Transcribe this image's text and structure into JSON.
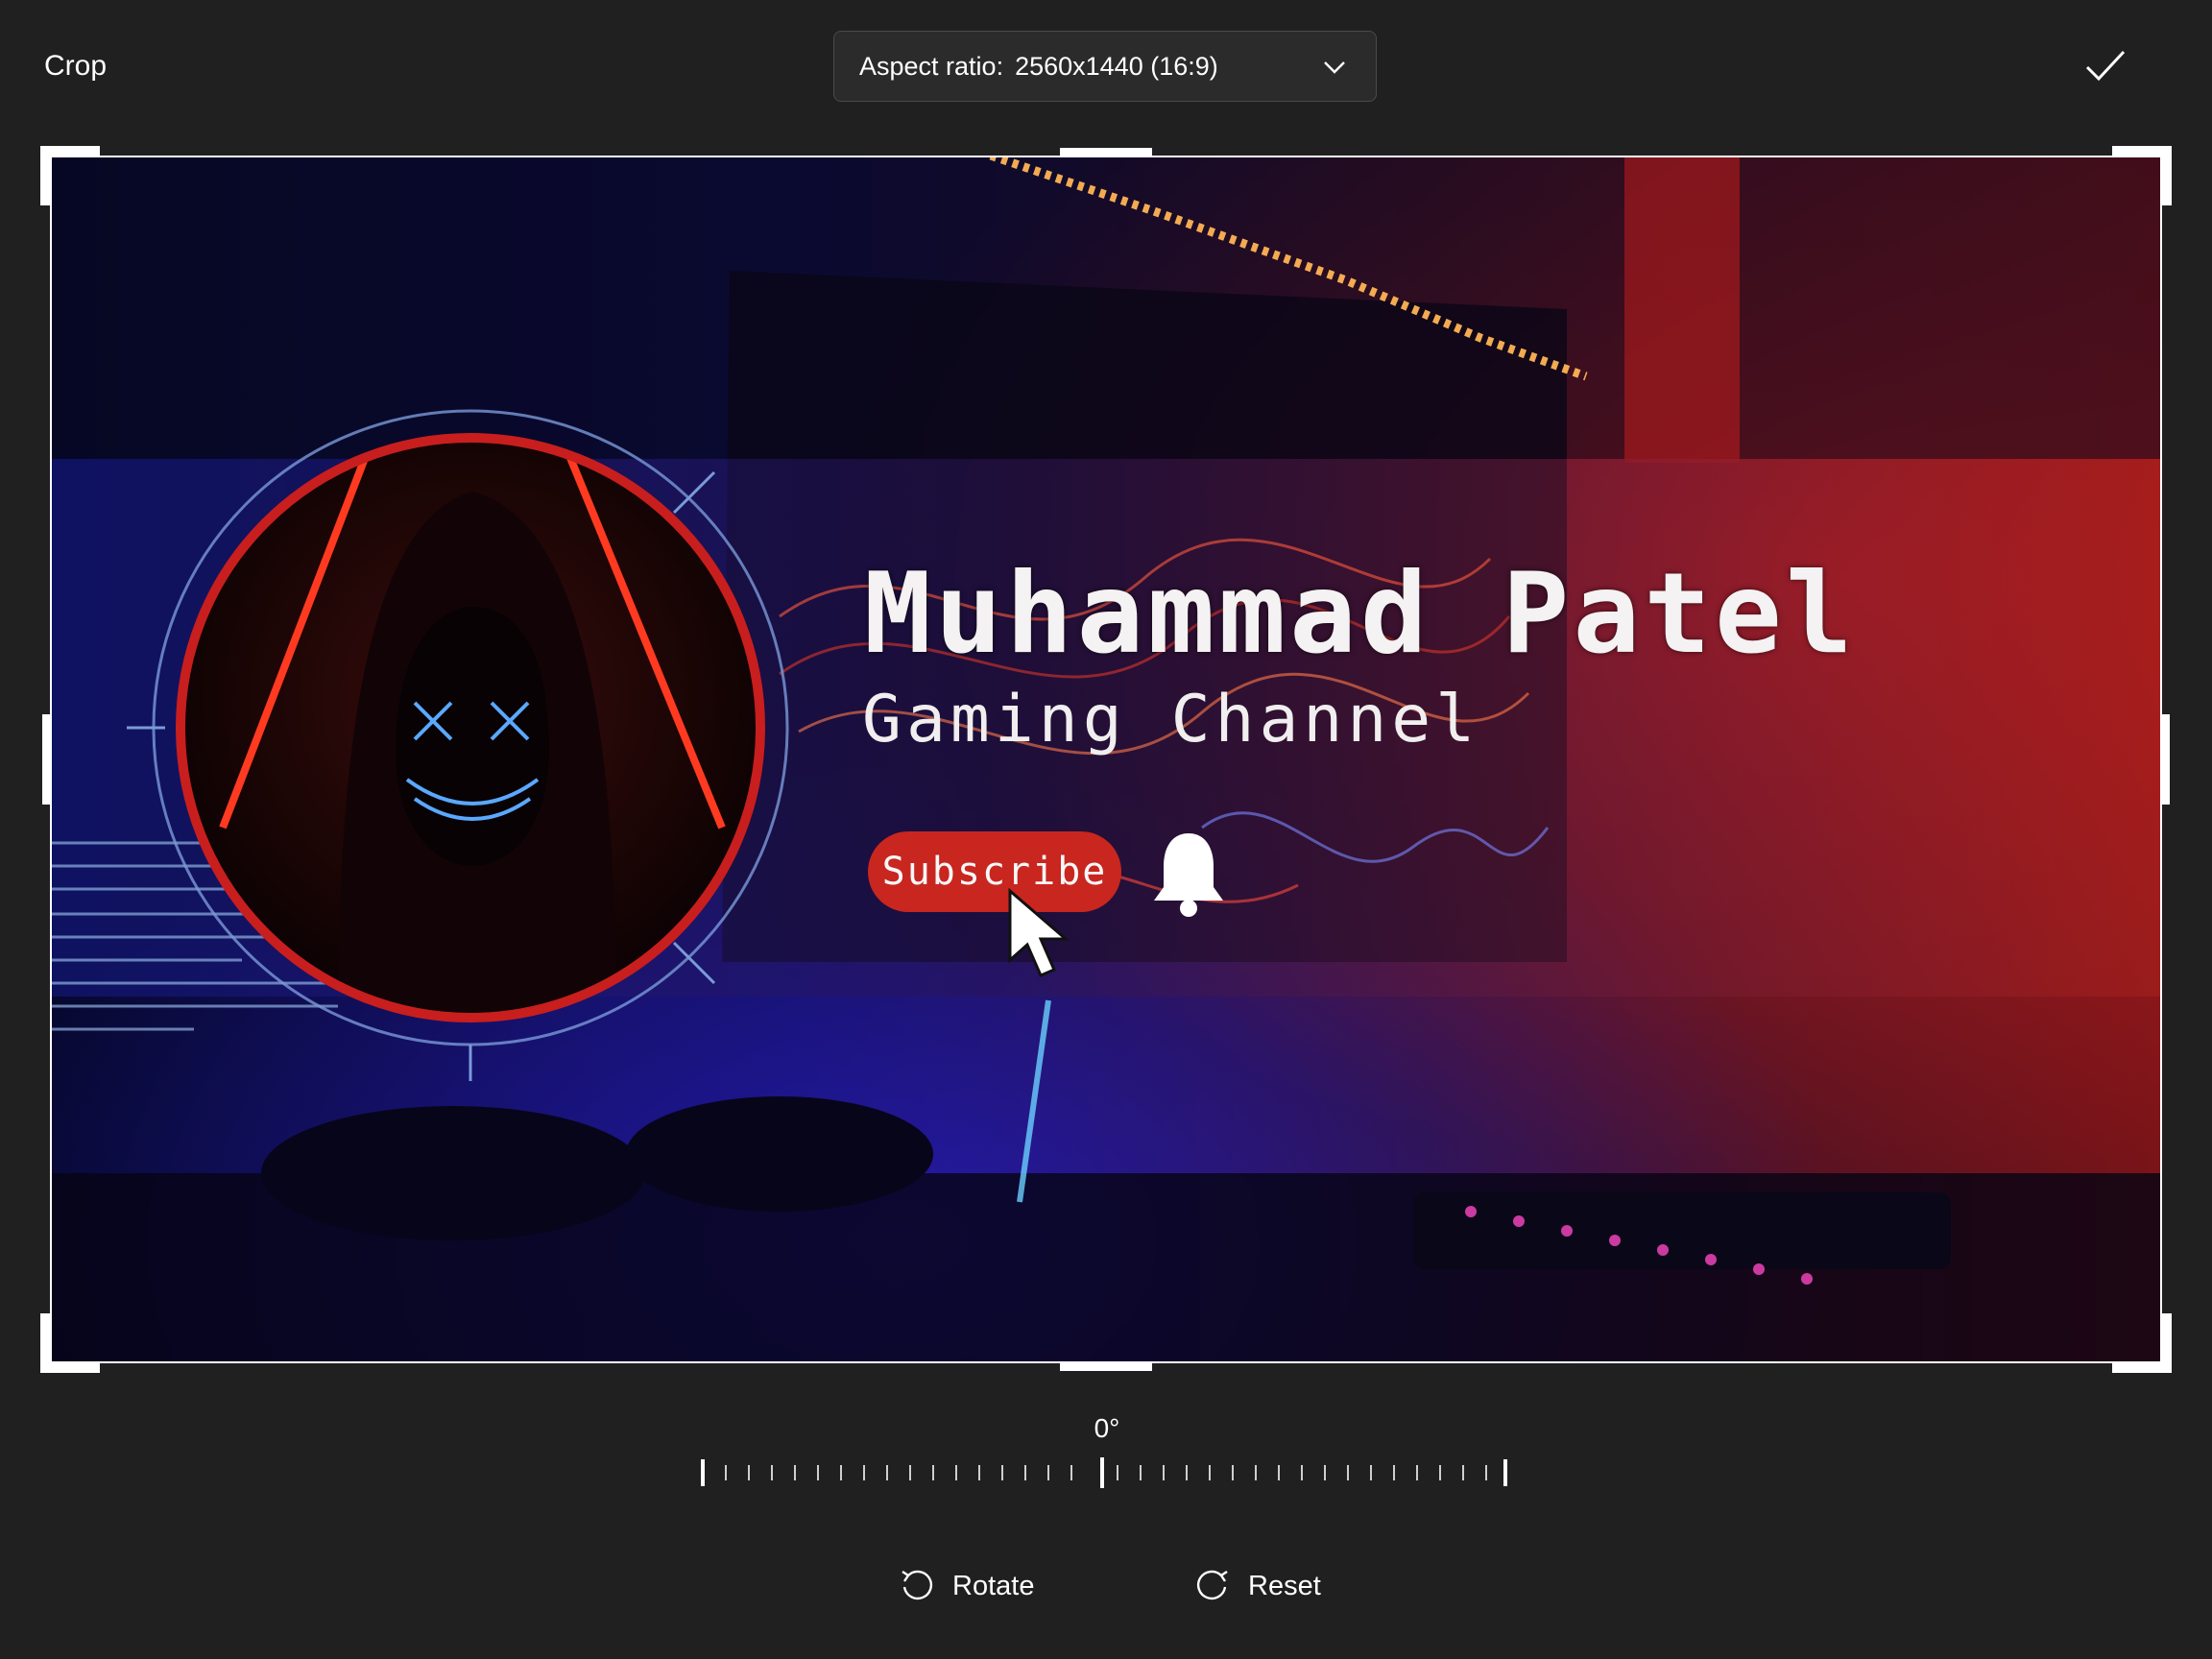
{
  "toolbar": {
    "title": "Crop",
    "aspect_label": "Aspect ratio:",
    "aspect_value": "2560x1440 (16:9)",
    "confirm_icon": "checkmark-icon",
    "dropdown_icon": "chevron-down-icon"
  },
  "image": {
    "title": "Muhammad Patel",
    "subtitle": "Gaming Channel",
    "subscribe_label": "Subscribe",
    "bell_icon": "bell-icon",
    "cursor_icon": "pointer-cursor-icon"
  },
  "rotation": {
    "angle": "0°"
  },
  "actions": {
    "rotate_label": "Rotate",
    "reset_label": "Reset",
    "rotate_icon": "rotate-ccw-icon",
    "reset_icon": "reset-cw-icon"
  },
  "colors": {
    "background": "#202020",
    "accent_red": "#c8261f",
    "deep_blue": "#1a1470"
  }
}
